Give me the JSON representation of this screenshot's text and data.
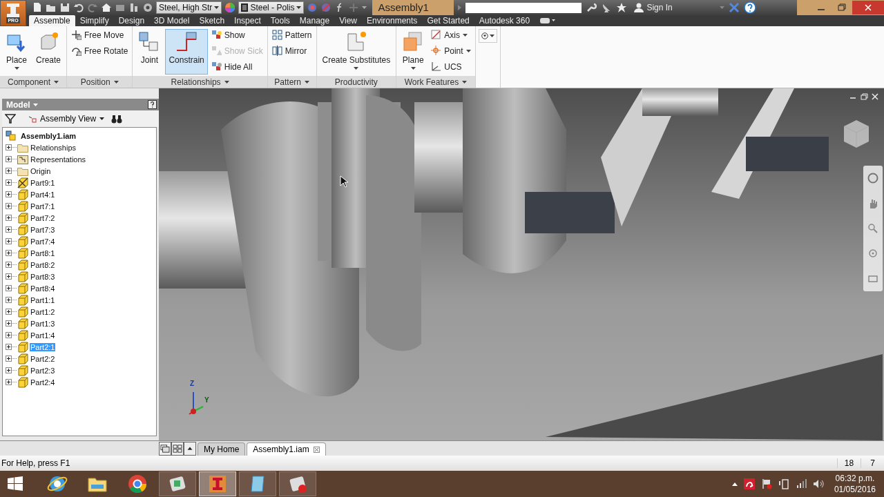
{
  "title_bar": {
    "logo_badge": "PRO",
    "materials": [
      "Steel, High Str",
      "Steel - Polis"
    ],
    "title": "Assembly1",
    "sign_in": "Sign In"
  },
  "tabs": [
    {
      "label": "Assemble",
      "selected": true
    },
    {
      "label": "Simplify",
      "selected": false
    },
    {
      "label": "Design",
      "selected": false
    },
    {
      "label": "3D Model",
      "selected": false
    },
    {
      "label": "Sketch",
      "selected": false
    },
    {
      "label": "Inspect",
      "selected": false
    },
    {
      "label": "Tools",
      "selected": false
    },
    {
      "label": "Manage",
      "selected": false
    },
    {
      "label": "View",
      "selected": false
    },
    {
      "label": "Environments",
      "selected": false
    },
    {
      "label": "Get Started",
      "selected": false
    },
    {
      "label": "Autodesk 360",
      "selected": false
    }
  ],
  "ribbon": [
    {
      "label": "Component",
      "tools": [
        {
          "label": "Place",
          "kind": "large",
          "dropdown": true,
          "selected": false,
          "disabled": false
        },
        {
          "label": "Create",
          "kind": "large",
          "dropdown": false,
          "selected": false,
          "disabled": false
        }
      ]
    },
    {
      "label": "Position",
      "tools": [
        {
          "label": "Free Move",
          "kind": "small",
          "dropdown": false,
          "selected": false,
          "disabled": false
        },
        {
          "label": "Free Rotate",
          "kind": "small",
          "dropdown": false,
          "selected": false,
          "disabled": false
        }
      ]
    },
    {
      "label": "Relationships",
      "tools": [
        {
          "label": "Joint",
          "kind": "large",
          "dropdown": false,
          "selected": false,
          "disabled": false
        },
        {
          "label": "Constrain",
          "kind": "large",
          "dropdown": false,
          "selected": true,
          "disabled": false
        },
        {
          "label": "Show",
          "kind": "small",
          "dropdown": false,
          "selected": false,
          "disabled": false
        },
        {
          "label": "Show Sick",
          "kind": "small",
          "dropdown": false,
          "selected": false,
          "disabled": true
        },
        {
          "label": "Hide All",
          "kind": "small",
          "dropdown": false,
          "selected": false,
          "disabled": false
        }
      ]
    },
    {
      "label": "Pattern",
      "tools": [
        {
          "label": "Pattern",
          "kind": "small",
          "dropdown": false,
          "selected": false,
          "disabled": false
        },
        {
          "label": "Mirror",
          "kind": "small",
          "dropdown": false,
          "selected": false,
          "disabled": false
        }
      ]
    },
    {
      "label": "Productivity",
      "tools": [
        {
          "label": "Create Substitutes",
          "kind": "large",
          "dropdown": true,
          "selected": false,
          "disabled": false
        }
      ]
    },
    {
      "label": "Work Features",
      "tools": [
        {
          "label": "Plane",
          "kind": "large",
          "dropdown": true,
          "selected": false,
          "disabled": false
        },
        {
          "label": "Axis",
          "kind": "small",
          "dropdown": true,
          "selected": false,
          "disabled": false
        },
        {
          "label": "Point",
          "kind": "small",
          "dropdown": true,
          "selected": false,
          "disabled": false
        },
        {
          "label": "UCS",
          "kind": "small",
          "dropdown": false,
          "selected": false,
          "disabled": false
        }
      ]
    }
  ],
  "browser": {
    "title": "Model",
    "view": "Assembly View",
    "root": "Assembly1.iam",
    "children": [
      {
        "label": "Relationships",
        "kind": "folder",
        "expanded": false,
        "selected": false
      },
      {
        "label": "Representations",
        "kind": "representations",
        "expanded": false,
        "selected": false
      },
      {
        "label": "Origin",
        "kind": "folder",
        "expanded": false,
        "selected": false
      },
      {
        "label": "Part9:1",
        "kind": "grounded",
        "expanded": false,
        "selected": false
      },
      {
        "label": "Part4:1",
        "kind": "part",
        "expanded": false,
        "selected": false
      },
      {
        "label": "Part7:1",
        "kind": "part",
        "expanded": false,
        "selected": false
      },
      {
        "label": "Part7:2",
        "kind": "part",
        "expanded": false,
        "selected": false
      },
      {
        "label": "Part7:3",
        "kind": "part",
        "expanded": false,
        "selected": false
      },
      {
        "label": "Part7:4",
        "kind": "part",
        "expanded": false,
        "selected": false
      },
      {
        "label": "Part8:1",
        "kind": "part",
        "expanded": false,
        "selected": false
      },
      {
        "label": "Part8:2",
        "kind": "part",
        "expanded": false,
        "selected": false
      },
      {
        "label": "Part8:3",
        "kind": "part",
        "expanded": false,
        "selected": false
      },
      {
        "label": "Part8:4",
        "kind": "part",
        "expanded": false,
        "selected": false
      },
      {
        "label": "Part1:1",
        "kind": "part",
        "expanded": false,
        "selected": false
      },
      {
        "label": "Part1:2",
        "kind": "part",
        "expanded": false,
        "selected": false
      },
      {
        "label": "Part1:3",
        "kind": "part",
        "expanded": false,
        "selected": false
      },
      {
        "label": "Part1:4",
        "kind": "part",
        "expanded": false,
        "selected": false
      },
      {
        "label": "Part2:1",
        "kind": "part",
        "expanded": false,
        "selected": true
      },
      {
        "label": "Part2:2",
        "kind": "part",
        "expanded": false,
        "selected": false
      },
      {
        "label": "Part2:3",
        "kind": "part",
        "expanded": false,
        "selected": false
      },
      {
        "label": "Part2:4",
        "kind": "part",
        "expanded": false,
        "selected": false
      }
    ]
  },
  "triad": {
    "z": "Z",
    "y": "Y"
  },
  "doc_tabs": [
    {
      "label": "My Home",
      "selected": false,
      "closable": false
    },
    {
      "label": "Assembly1.iam",
      "selected": true,
      "closable": true
    }
  ],
  "status_bar": {
    "help": "For Help, press F1",
    "fields": [
      "18",
      "7"
    ]
  },
  "taskbar": {
    "apps": [
      {
        "kind": "ie",
        "selected": false
      },
      {
        "kind": "folder",
        "selected": false
      },
      {
        "kind": "chrome",
        "selected": false
      },
      {
        "kind": "app",
        "selected": false
      },
      {
        "kind": "inventor",
        "selected": true
      },
      {
        "kind": "notepad",
        "selected": false
      },
      {
        "kind": "recorder",
        "selected": false
      }
    ],
    "time": "06:32 p.m.",
    "date": "01/05/2016"
  }
}
